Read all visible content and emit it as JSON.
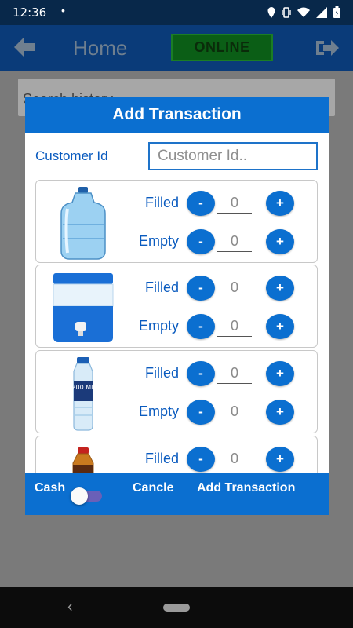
{
  "status_bar": {
    "time": "12:36",
    "dot": "•"
  },
  "app_bar": {
    "title": "Home",
    "status": "ONLINE"
  },
  "background": {
    "search_hint": "Search history"
  },
  "dialog": {
    "title": "Add Transaction",
    "customer_label": "Customer Id",
    "customer_placeholder": "Customer Id..",
    "products": [
      {
        "name": "water-jar-bottle",
        "filled": "0",
        "empty": "0"
      },
      {
        "name": "water-cooler-camper",
        "filled": "0",
        "empty": "0",
        "badge": ""
      },
      {
        "name": "200ml-water-bottle",
        "badge": "200 ML",
        "filled": "0",
        "empty": "0"
      },
      {
        "name": "red-cap-bottle",
        "filled": "0"
      }
    ],
    "filled_label": "Filled",
    "empty_label": "Empty",
    "minus": "-",
    "plus": "+",
    "footer": {
      "cash": "Cash",
      "cancel": "Cancle",
      "add": "Add Transaction",
      "cash_toggle_on": false
    }
  },
  "colors": {
    "primary": "#0b6fd0",
    "app_bar": "#0a3b79",
    "online": "#0b5e16"
  }
}
